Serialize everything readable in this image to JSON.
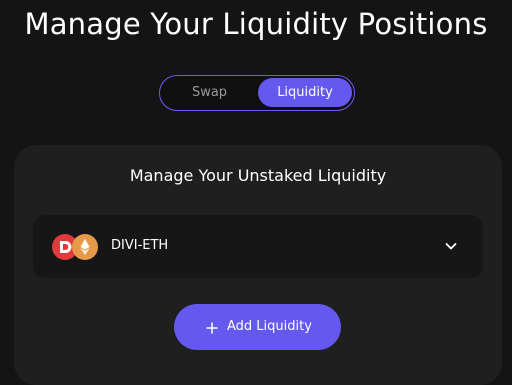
{
  "page": {
    "title": "Manage Your Liquidity Positions"
  },
  "toggle": {
    "options": [
      {
        "label": "Swap",
        "active": false
      },
      {
        "label": "Liquidity",
        "active": true
      }
    ]
  },
  "card": {
    "title": "Manage Your Unstaked Liquidity",
    "pools": [
      {
        "pair": "DIVI-ETH",
        "icons": [
          "divi-token-icon",
          "eth-token-icon"
        ],
        "expand_icon": "chevron-down-icon"
      }
    ],
    "add_button": {
      "label": "Add Liquidity",
      "icon": "plus-icon"
    }
  },
  "colors": {
    "background": "#141414",
    "card": "#1f1f1f",
    "row": "#161616",
    "accent": "#6558ee",
    "toggle_border": "#6a5cf0",
    "divi_red": "#e03a3e",
    "eth_orange": "#e59a49",
    "muted_text": "#9a9a9a"
  }
}
